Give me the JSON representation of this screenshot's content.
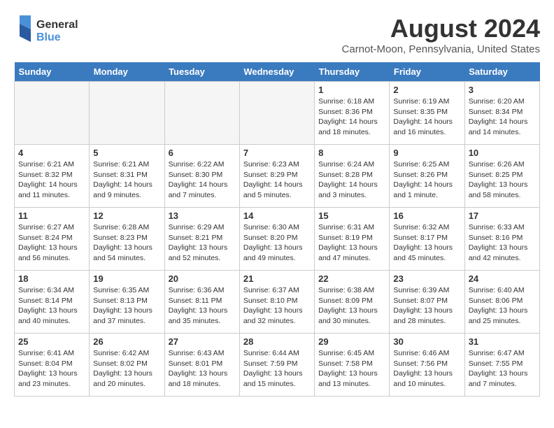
{
  "header": {
    "logo": {
      "general": "General",
      "blue": "Blue"
    },
    "title": "August 2024",
    "location": "Carnot-Moon, Pennsylvania, United States"
  },
  "weekdays": [
    "Sunday",
    "Monday",
    "Tuesday",
    "Wednesday",
    "Thursday",
    "Friday",
    "Saturday"
  ],
  "weeks": [
    [
      {
        "day": "",
        "empty": true
      },
      {
        "day": "",
        "empty": true
      },
      {
        "day": "",
        "empty": true
      },
      {
        "day": "",
        "empty": true
      },
      {
        "day": "1",
        "info": "Sunrise: 6:18 AM\nSunset: 8:36 PM\nDaylight: 14 hours\nand 18 minutes."
      },
      {
        "day": "2",
        "info": "Sunrise: 6:19 AM\nSunset: 8:35 PM\nDaylight: 14 hours\nand 16 minutes."
      },
      {
        "day": "3",
        "info": "Sunrise: 6:20 AM\nSunset: 8:34 PM\nDaylight: 14 hours\nand 14 minutes."
      }
    ],
    [
      {
        "day": "4",
        "info": "Sunrise: 6:21 AM\nSunset: 8:32 PM\nDaylight: 14 hours\nand 11 minutes."
      },
      {
        "day": "5",
        "info": "Sunrise: 6:21 AM\nSunset: 8:31 PM\nDaylight: 14 hours\nand 9 minutes."
      },
      {
        "day": "6",
        "info": "Sunrise: 6:22 AM\nSunset: 8:30 PM\nDaylight: 14 hours\nand 7 minutes."
      },
      {
        "day": "7",
        "info": "Sunrise: 6:23 AM\nSunset: 8:29 PM\nDaylight: 14 hours\nand 5 minutes."
      },
      {
        "day": "8",
        "info": "Sunrise: 6:24 AM\nSunset: 8:28 PM\nDaylight: 14 hours\nand 3 minutes."
      },
      {
        "day": "9",
        "info": "Sunrise: 6:25 AM\nSunset: 8:26 PM\nDaylight: 14 hours\nand 1 minute."
      },
      {
        "day": "10",
        "info": "Sunrise: 6:26 AM\nSunset: 8:25 PM\nDaylight: 13 hours\nand 58 minutes."
      }
    ],
    [
      {
        "day": "11",
        "info": "Sunrise: 6:27 AM\nSunset: 8:24 PM\nDaylight: 13 hours\nand 56 minutes."
      },
      {
        "day": "12",
        "info": "Sunrise: 6:28 AM\nSunset: 8:23 PM\nDaylight: 13 hours\nand 54 minutes."
      },
      {
        "day": "13",
        "info": "Sunrise: 6:29 AM\nSunset: 8:21 PM\nDaylight: 13 hours\nand 52 minutes."
      },
      {
        "day": "14",
        "info": "Sunrise: 6:30 AM\nSunset: 8:20 PM\nDaylight: 13 hours\nand 49 minutes."
      },
      {
        "day": "15",
        "info": "Sunrise: 6:31 AM\nSunset: 8:19 PM\nDaylight: 13 hours\nand 47 minutes."
      },
      {
        "day": "16",
        "info": "Sunrise: 6:32 AM\nSunset: 8:17 PM\nDaylight: 13 hours\nand 45 minutes."
      },
      {
        "day": "17",
        "info": "Sunrise: 6:33 AM\nSunset: 8:16 PM\nDaylight: 13 hours\nand 42 minutes."
      }
    ],
    [
      {
        "day": "18",
        "info": "Sunrise: 6:34 AM\nSunset: 8:14 PM\nDaylight: 13 hours\nand 40 minutes."
      },
      {
        "day": "19",
        "info": "Sunrise: 6:35 AM\nSunset: 8:13 PM\nDaylight: 13 hours\nand 37 minutes."
      },
      {
        "day": "20",
        "info": "Sunrise: 6:36 AM\nSunset: 8:11 PM\nDaylight: 13 hours\nand 35 minutes."
      },
      {
        "day": "21",
        "info": "Sunrise: 6:37 AM\nSunset: 8:10 PM\nDaylight: 13 hours\nand 32 minutes."
      },
      {
        "day": "22",
        "info": "Sunrise: 6:38 AM\nSunset: 8:09 PM\nDaylight: 13 hours\nand 30 minutes."
      },
      {
        "day": "23",
        "info": "Sunrise: 6:39 AM\nSunset: 8:07 PM\nDaylight: 13 hours\nand 28 minutes."
      },
      {
        "day": "24",
        "info": "Sunrise: 6:40 AM\nSunset: 8:06 PM\nDaylight: 13 hours\nand 25 minutes."
      }
    ],
    [
      {
        "day": "25",
        "info": "Sunrise: 6:41 AM\nSunset: 8:04 PM\nDaylight: 13 hours\nand 23 minutes."
      },
      {
        "day": "26",
        "info": "Sunrise: 6:42 AM\nSunset: 8:02 PM\nDaylight: 13 hours\nand 20 minutes."
      },
      {
        "day": "27",
        "info": "Sunrise: 6:43 AM\nSunset: 8:01 PM\nDaylight: 13 hours\nand 18 minutes."
      },
      {
        "day": "28",
        "info": "Sunrise: 6:44 AM\nSunset: 7:59 PM\nDaylight: 13 hours\nand 15 minutes."
      },
      {
        "day": "29",
        "info": "Sunrise: 6:45 AM\nSunset: 7:58 PM\nDaylight: 13 hours\nand 13 minutes."
      },
      {
        "day": "30",
        "info": "Sunrise: 6:46 AM\nSunset: 7:56 PM\nDaylight: 13 hours\nand 10 minutes."
      },
      {
        "day": "31",
        "info": "Sunrise: 6:47 AM\nSunset: 7:55 PM\nDaylight: 13 hours\nand 7 minutes."
      }
    ]
  ]
}
